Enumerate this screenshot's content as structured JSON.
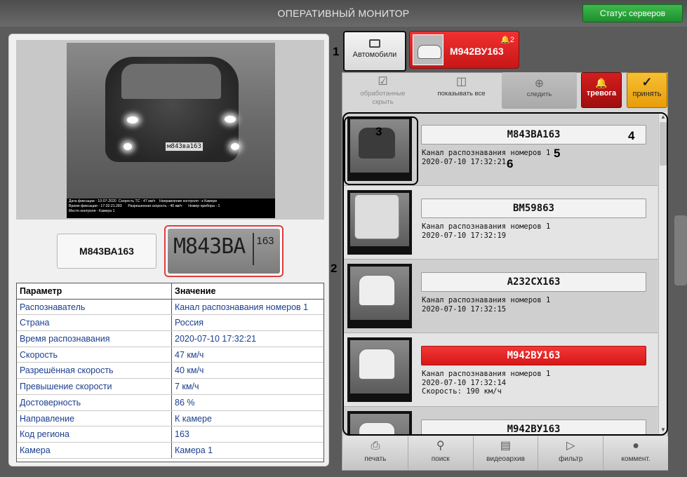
{
  "window": {
    "title": "ОПЕРАТИВНЫЙ МОНИТОР",
    "status_button": "Статус серверов"
  },
  "left": {
    "photo_caption": [
      "Дата фиксации - 10-07-2020  Скорость ТС - 47 км/ч    Направление контроля - к Камере",
      "Время фиксации - 17:32:21.283      Разрешенная скорость - 40 км/ч      Номер прибора - 1",
      "Место контроля - Камера 1"
    ],
    "small_plate": "м843ва163",
    "recognized_plate": "М843ВА163",
    "plate_crop_text": "М843ВА",
    "plate_crop_region": "163",
    "table": {
      "headers": [
        "Параметр",
        "Значение"
      ],
      "rows": [
        [
          "Распознаватель",
          "Канал распознавания номеров 1"
        ],
        [
          "Страна",
          "Россия"
        ],
        [
          "Время распознавания",
          "2020-07-10 17:32:21"
        ],
        [
          "Скорость",
          "47 км/ч"
        ],
        [
          "Разрешённая скорость",
          "40 км/ч"
        ],
        [
          "Превышение скорости",
          "7 км/ч"
        ],
        [
          "Достоверность",
          "86 %"
        ],
        [
          "Направление",
          "К камере"
        ],
        [
          "Код региона",
          "163"
        ],
        [
          "Камера",
          "Камера 1"
        ]
      ]
    }
  },
  "tabs": {
    "auto_label": "Автомобили",
    "alarm_plate": "М942ВУ163",
    "alarm_count": "2"
  },
  "toolbar": {
    "processed_hide": "обработанные скрыть",
    "show_all": "показывать все",
    "follow": "следить",
    "alarm": "тревога",
    "accept": "принять"
  },
  "events": [
    {
      "plate": "М843ВА163",
      "channel": "Канал распознавания номеров 1",
      "time": "2020-07-10 17:32:21",
      "speed": "",
      "alarm": false
    },
    {
      "plate": "ВМ59863",
      "channel": "Канал распознавания номеров 1",
      "time": "2020-07-10 17:32:19",
      "speed": "",
      "alarm": false
    },
    {
      "plate": "А232СХ163",
      "channel": "Канал распознавания номеров 1",
      "time": "2020-07-10 17:32:15",
      "speed": "",
      "alarm": false
    },
    {
      "plate": "М942ВУ163",
      "channel": "Канал распознавания номеров 1",
      "time": "2020-07-10 17:32:14",
      "speed": "Скорость: 190 км/ч",
      "alarm": true
    },
    {
      "plate": "М942ВУ163",
      "channel": "",
      "time": "",
      "speed": "",
      "alarm": false
    }
  ],
  "bottom_bar": [
    "печать",
    "поиск",
    "видеоархив",
    "фильтр",
    "коммент."
  ],
  "callouts": [
    "1",
    "2",
    "3",
    "4",
    "5",
    "6"
  ],
  "colors": {
    "alarm_red": "#e02020",
    "accept_orange": "#f0b020",
    "status_green": "#2aa63a"
  }
}
